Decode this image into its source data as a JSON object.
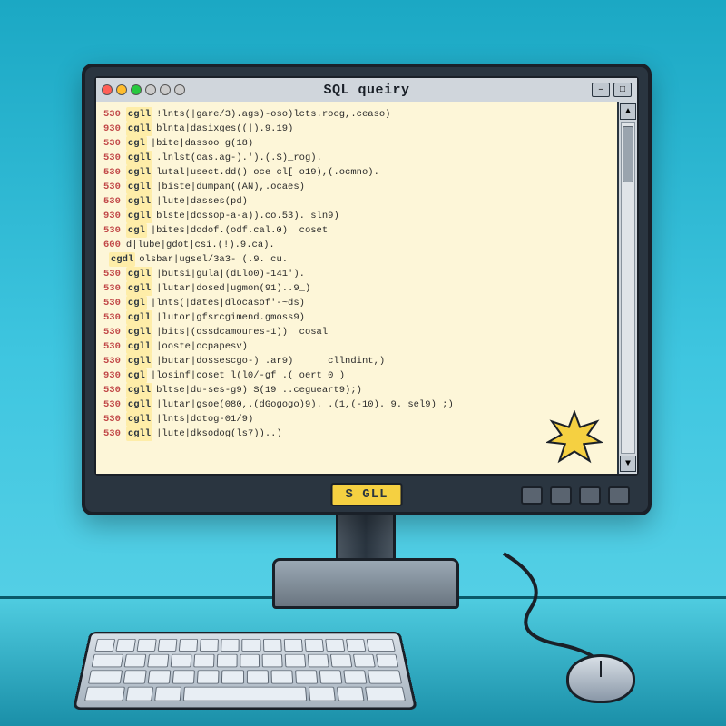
{
  "window": {
    "title": "SQL queiry",
    "min_label": "–",
    "max_label": "□"
  },
  "code_lines": [
    {
      "ln": "530",
      "kw": "cgll",
      "txt": "!lnts(|gare/3).ags)-oso)lcts.roog,.ceaso)"
    },
    {
      "ln": "930",
      "kw": "cgll",
      "txt": "blnta|dasixges((|).9.19)"
    },
    {
      "ln": "530",
      "kw": "cgl",
      "txt": "|bite|dassoo g(18)"
    },
    {
      "ln": "530",
      "kw": "cgll",
      "txt": ".lnlst(oas.ag-).').(.S)_rog)."
    },
    {
      "ln": "530",
      "kw": "cgll",
      "txt": "lutal|usect.dd() oce cl[ o19),(.ocmno)."
    },
    {
      "ln": "530",
      "kw": "cgll",
      "txt": "|biste|dumpan((AN),.ocaes)"
    },
    {
      "ln": "530",
      "kw": "cgll",
      "txt": "|lute|dasses(pd)"
    },
    {
      "ln": "930",
      "kw": "cgll",
      "txt": "blste|dossop-a-a)).co.53). sln9)"
    },
    {
      "ln": "530",
      "kw": "cgl",
      "txt": "|bites|dodof.(odf.cal.0)  coset"
    },
    {
      "ln": "600",
      "kw": "",
      "txt": "d|lube|gdot|csi.(!).9.ca)."
    },
    {
      "ln": "",
      "kw": "cgdl",
      "txt": "olsbar|ugsel/3a3- (.9. cu."
    },
    {
      "ln": "530",
      "kw": "cgll",
      "txt": "|butsi|gula|(dLlo0)-141')."
    },
    {
      "ln": "530",
      "kw": "cgll",
      "txt": "|lutar|dosed|ugmon(91)..9_)"
    },
    {
      "ln": "530",
      "kw": "cgl",
      "txt": "|lnts(|dates|dlocasof'-~ds)"
    },
    {
      "ln": "530",
      "kw": "cgll",
      "txt": "|lutor|gfsrcgimend.gmoss9)"
    },
    {
      "ln": "530",
      "kw": "cgll",
      "txt": "|bits|(ossdcamoures-1))  cosal"
    },
    {
      "ln": "530",
      "kw": "cgll",
      "txt": "|ooste|ocpapesv)"
    },
    {
      "ln": "530",
      "kw": "cgll",
      "txt": "|butar|dossescgo-) .ar9)      cllndint,)"
    },
    {
      "ln": "930",
      "kw": "cgl",
      "txt": "|losinf|coset l(l0/-gf .( oert 0 )"
    },
    {
      "ln": "530",
      "kw": "cgll",
      "txt": "bltse|du-ses-g9) S(19 ..cegueart9);)"
    },
    {
      "ln": "530",
      "kw": "cgll",
      "txt": "|lutar|gsoe(080,.(dGogogo)9). .(1,(-10). 9. sel9) ;)"
    },
    {
      "ln": "530",
      "kw": "cgll",
      "txt": "|lnts|dotog-01/9)"
    },
    {
      "ln": "530",
      "kw": "cgll",
      "txt": "|lute|dksodog(ls7))..)"
    }
  ],
  "logo_label": "S GLL"
}
